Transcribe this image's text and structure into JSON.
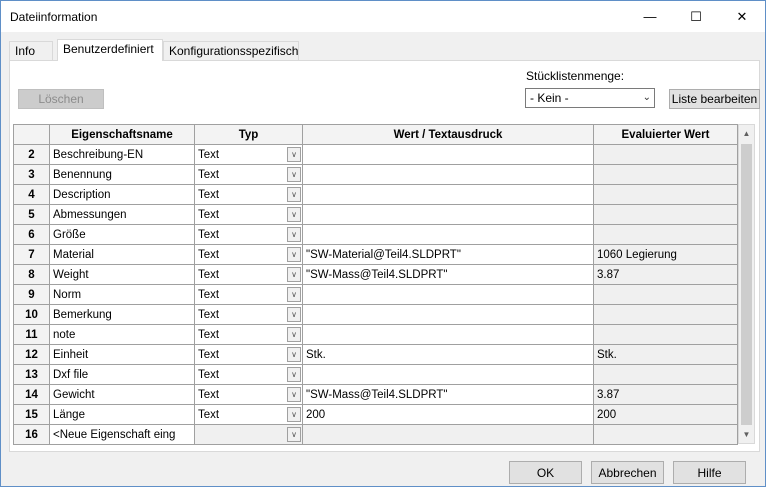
{
  "window": {
    "title": "Dateiinformation",
    "minimize": "—",
    "maximize": "☐",
    "close": "✕"
  },
  "tabs": [
    {
      "label": "Info"
    },
    {
      "label": "Benutzerdefiniert"
    },
    {
      "label": "Konfigurationsspezifisch"
    }
  ],
  "toolbar": {
    "delete_label": "Löschen",
    "bom_qty_label": "Stücklistenmenge:",
    "bom_qty_value": "- Kein -",
    "edit_list_label": "Liste bearbeiten"
  },
  "grid": {
    "headers": [
      "Eigenschaftsname",
      "Typ",
      "Wert / Textausdruck",
      "Evaluierter Wert"
    ],
    "rows": [
      {
        "num": "2",
        "name": "Beschreibung-EN",
        "type": "Text",
        "value": "",
        "evaluated": ""
      },
      {
        "num": "3",
        "name": "Benennung",
        "type": "Text",
        "value": "",
        "evaluated": ""
      },
      {
        "num": "4",
        "name": "Description",
        "type": "Text",
        "value": "",
        "evaluated": ""
      },
      {
        "num": "5",
        "name": "Abmessungen",
        "type": "Text",
        "value": "",
        "evaluated": ""
      },
      {
        "num": "6",
        "name": "Größe",
        "type": "Text",
        "value": "",
        "evaluated": ""
      },
      {
        "num": "7",
        "name": "Material",
        "type": "Text",
        "value": "\"SW-Material@Teil4.SLDPRT\"",
        "evaluated": "1060 Legierung"
      },
      {
        "num": "8",
        "name": "Weight",
        "type": "Text",
        "value": "\"SW-Mass@Teil4.SLDPRT\"",
        "evaluated": "3.87"
      },
      {
        "num": "9",
        "name": "Norm",
        "type": "Text",
        "value": "",
        "evaluated": ""
      },
      {
        "num": "10",
        "name": "Bemerkung",
        "type": "Text",
        "value": "",
        "evaluated": ""
      },
      {
        "num": "11",
        "name": "note",
        "type": "Text",
        "value": "",
        "evaluated": ""
      },
      {
        "num": "12",
        "name": "Einheit",
        "type": "Text",
        "value": "Stk.",
        "evaluated": "Stk."
      },
      {
        "num": "13",
        "name": "Dxf file",
        "type": "Text",
        "value": "",
        "evaluated": ""
      },
      {
        "num": "14",
        "name": "Gewicht",
        "type": "Text",
        "value": "\"SW-Mass@Teil4.SLDPRT\"",
        "evaluated": "3.87"
      },
      {
        "num": "15",
        "name": "Länge",
        "type": "Text",
        "value": "200",
        "evaluated": "200"
      },
      {
        "num": "16",
        "name": "<Neue Eigenschaft eing",
        "type": "",
        "value": "",
        "evaluated": ""
      }
    ]
  },
  "footer": {
    "ok_label": "OK",
    "cancel_label": "Abbrechen",
    "help_label": "Hilfe"
  }
}
